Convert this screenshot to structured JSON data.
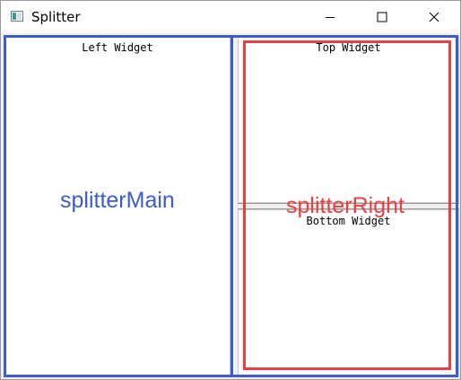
{
  "window": {
    "title": "Splitter",
    "icon": "app-window-icon",
    "controls": {
      "minimize_icon": "minimize-icon",
      "maximize_icon": "maximize-icon",
      "close_icon": "close-icon"
    }
  },
  "panes": {
    "left": {
      "label": "Left Widget"
    },
    "top": {
      "label": "Top Widget"
    },
    "bottom": {
      "label": "Bottom Widget"
    }
  },
  "annotations": {
    "splitter_main": {
      "label": "splitterMain",
      "color": "#3c5ccb"
    },
    "splitter_right": {
      "label": "splitterRight",
      "color": "#e84040"
    }
  }
}
